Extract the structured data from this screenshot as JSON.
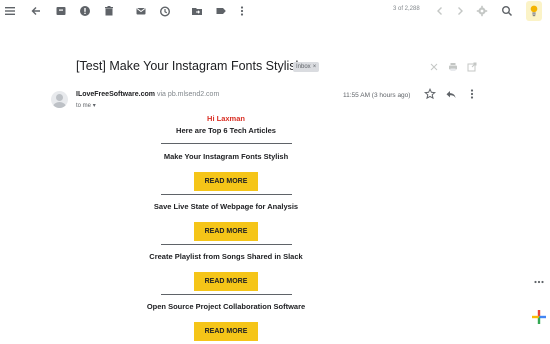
{
  "toolbar": {
    "pager": "3 of 2,288"
  },
  "email": {
    "subject": "[Test] Make Your Instagram Fonts Stylish",
    "label": "Inbox",
    "label_remove": "×",
    "sender_name": "ILoveFreeSoftware.com",
    "via": "via",
    "via_address": "pb.mlsend2.com",
    "to": "to me",
    "time": "11:55 AM (3 hours ago)"
  },
  "body": {
    "greeting": "Hi Laxman",
    "intro": "Here are Top 6 Tech Articles",
    "articles": [
      {
        "title": "Make Your Instagram Fonts Stylish",
        "button": "READ MORE"
      },
      {
        "title": "Save Live State of Webpage for Analysis",
        "button": "READ MORE"
      },
      {
        "title": "Create Playlist from Songs Shared in Slack",
        "button": "READ MORE"
      },
      {
        "title": "Open Source Project Collaboration Software",
        "button": "READ MORE"
      }
    ]
  },
  "icons": {
    "menu": "menu-icon",
    "back": "arrow-back-icon",
    "archive": "archive-icon",
    "spam": "report-spam-icon",
    "delete": "delete-icon",
    "unread": "mark-unread-icon",
    "snooze": "snooze-icon",
    "move": "move-to-icon",
    "label": "label-icon",
    "more": "more-vert-icon",
    "prev": "chevron-left-icon",
    "next": "chevron-right-icon",
    "settings": "gear-icon",
    "search": "search-icon",
    "account": "account-avatar-icon"
  },
  "colors": {
    "greeting": "#d93025",
    "button": "#f5c518"
  }
}
